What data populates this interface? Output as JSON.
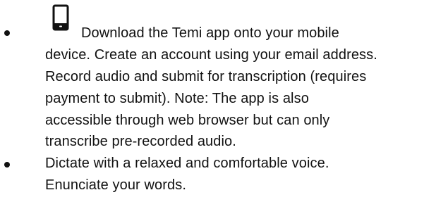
{
  "bullets": [
    {
      "icon": "mobile-phone-icon",
      "lines": [
        "Download the Temi app onto your mobile",
        "device. Create an account using your email address.",
        "Record audio and submit for transcription (requires",
        "payment to submit). Note: The app is also",
        "accessible through web browser but can only",
        "transcribe pre-recorded audio."
      ]
    },
    {
      "lines": [
        "Dictate with a relaxed and comfortable voice.",
        "Enunciate your words."
      ]
    }
  ]
}
